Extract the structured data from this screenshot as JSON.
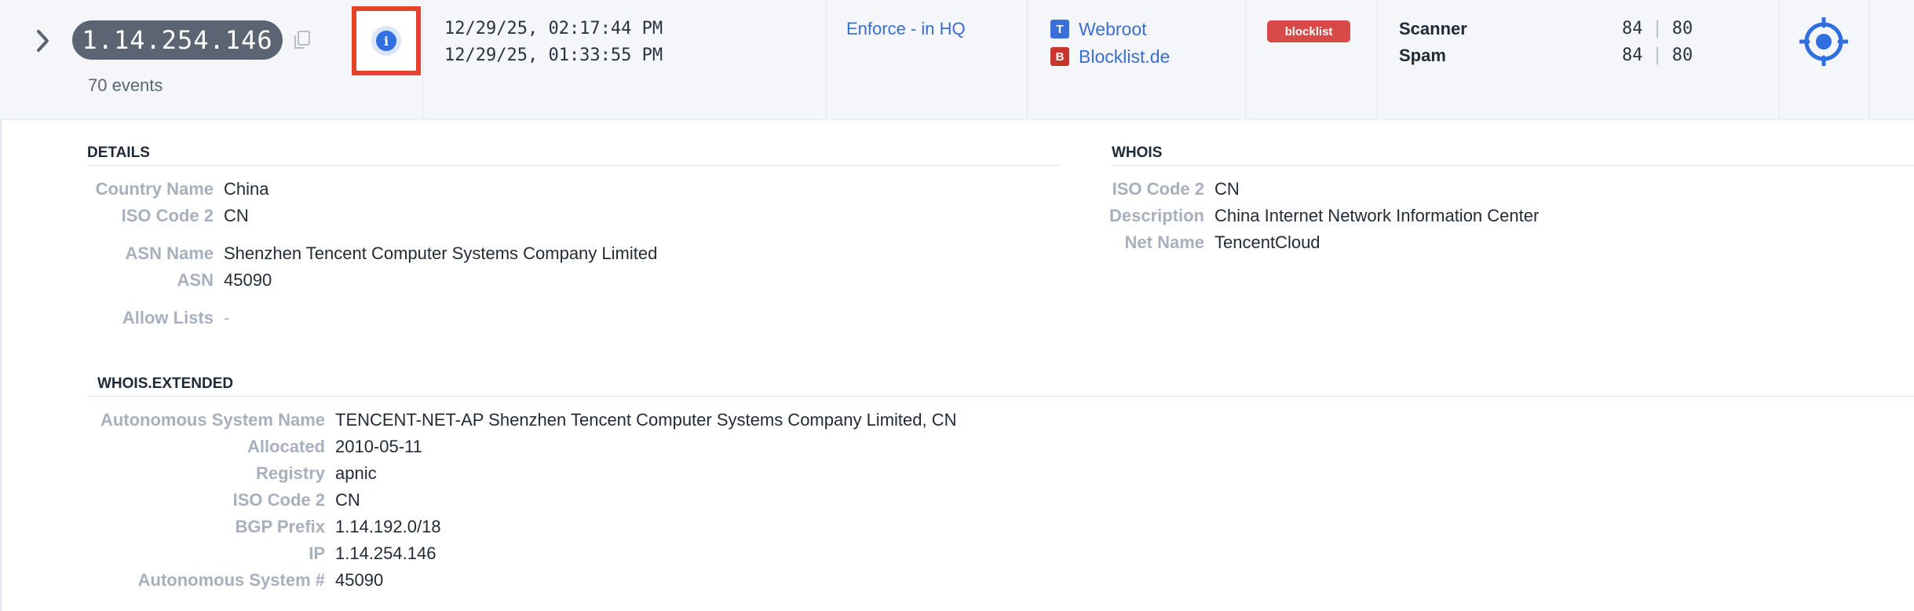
{
  "row": {
    "ip": "1.14.254.146",
    "events": "70 events",
    "timestamps": [
      "12/29/25, 02:17:44 PM",
      "12/29/25, 01:33:55 PM"
    ],
    "policy": "Enforce - in HQ",
    "sources": [
      {
        "badge": "T",
        "label": "Webroot",
        "color": "#3b6fd8"
      },
      {
        "badge": "B",
        "label": "Blocklist.de",
        "color": "#c8352b"
      }
    ],
    "tag": "blocklist",
    "categories": [
      {
        "name": "Scanner",
        "score_a": "84",
        "score_b": "80"
      },
      {
        "name": "Spam",
        "score_a": "84",
        "score_b": "80"
      }
    ]
  },
  "details": {
    "title": "DETAILS",
    "fields": [
      {
        "label": "Country Name",
        "value": "China"
      },
      {
        "label": "ISO Code 2",
        "value": "CN"
      },
      {
        "label": "ASN Name",
        "value": "Shenzhen Tencent Computer Systems Company Limited"
      },
      {
        "label": "ASN",
        "value": "45090"
      },
      {
        "label": "Allow Lists",
        "value": "-"
      }
    ]
  },
  "whois": {
    "title": "WHOIS",
    "fields": [
      {
        "label": "ISO Code 2",
        "value": "CN"
      },
      {
        "label": "Description",
        "value": "China Internet Network Information Center"
      },
      {
        "label": "Net Name",
        "value": "TencentCloud"
      }
    ]
  },
  "whois_extended": {
    "title": "WHOIS.EXTENDED",
    "fields": [
      {
        "label": "Autonomous System Name",
        "value": "TENCENT-NET-AP Shenzhen Tencent Computer Systems Company Limited, CN"
      },
      {
        "label": "Allocated",
        "value": "2010-05-11"
      },
      {
        "label": "Registry",
        "value": "apnic"
      },
      {
        "label": "ISO Code 2",
        "value": "CN"
      },
      {
        "label": "BGP Prefix",
        "value": "1.14.192.0/18"
      },
      {
        "label": "IP",
        "value": "1.14.254.146"
      },
      {
        "label": "Autonomous System #",
        "value": "45090"
      }
    ]
  }
}
